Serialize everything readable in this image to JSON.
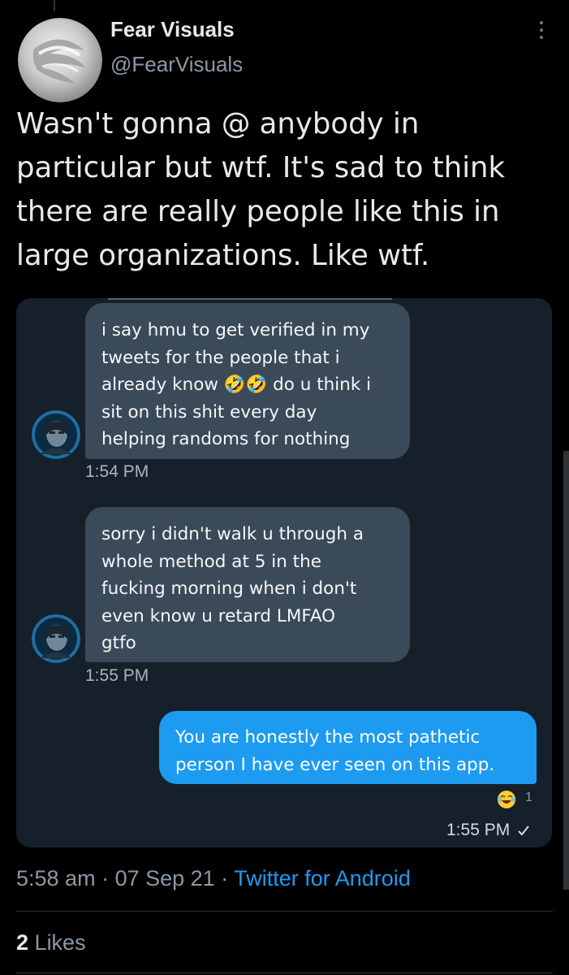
{
  "author": {
    "name": "Fear Visuals",
    "handle": "@FearVisuals"
  },
  "tweet": {
    "text": "Wasn't gonna @ anybody in\nparticular but wtf. It's sad to think\nthere are really people like this in\nlarge organizations. Like wtf."
  },
  "dm": {
    "messages": [
      {
        "lines": [
          "i say hmu to get verified in my",
          "tweets for the people that i",
          "already know 🤣🤣 do u think i",
          "sit on this shit every day",
          "helping randoms for nothing"
        ],
        "time": "1:54 PM"
      },
      {
        "lines": [
          "sorry i didn't walk u through a",
          "whole method at 5 in the",
          "fucking morning when i don't",
          "even know u retard LMFAO",
          "gtfo"
        ],
        "time": "1:55 PM"
      },
      {
        "lines": [
          "You are honestly the most pathetic",
          "person I have ever seen on this app."
        ],
        "time": "1:55 PM",
        "reaction_icon": "face-with-tears-of-joy-emoji",
        "reaction_count": "1",
        "status_icon": "read-check-icon"
      }
    ]
  },
  "meta": {
    "time": "5:58 am",
    "separator": "·",
    "date": "07 Sep 21",
    "source": "Twitter for Android"
  },
  "stats": {
    "likes_count": "2",
    "likes_label": "Likes"
  },
  "colors": {
    "background": "#000000",
    "dm_card": "#15202b",
    "received_bubble": "#3b4a58",
    "sent_bubble": "#1d9bf0",
    "link": "#1d9bf0",
    "secondary_text": "#8b98a5"
  },
  "icons": [
    "profile-avatar",
    "more-options-icon",
    "sender-avatar",
    "laughing-emoji-icon",
    "read-check-icon"
  ]
}
